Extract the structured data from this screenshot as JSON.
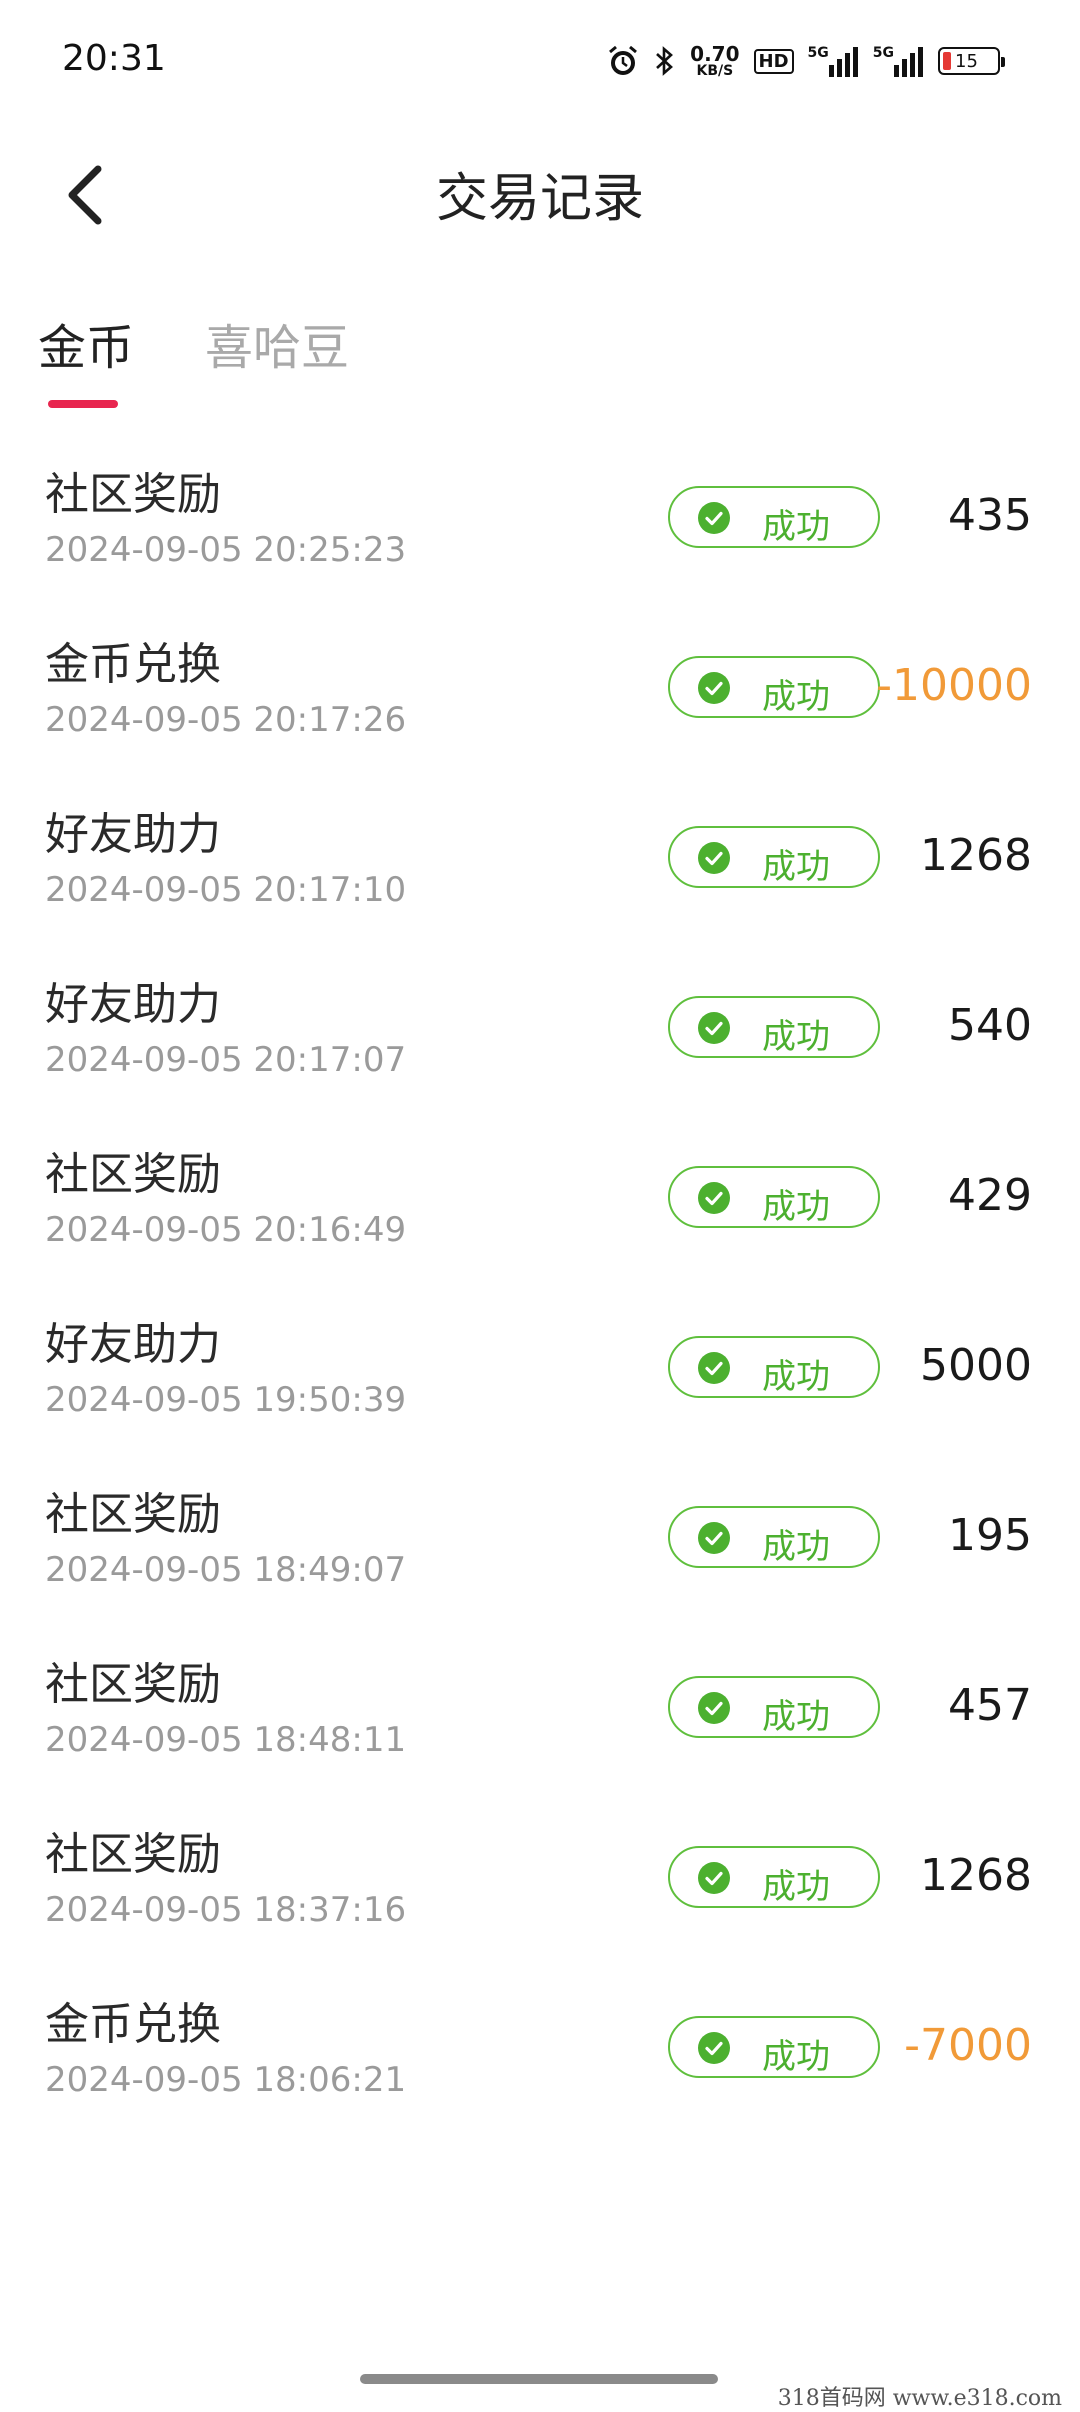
{
  "status_bar": {
    "time": "20:31",
    "net_speed_value": "0.70",
    "net_speed_unit": "KB/S",
    "hd_label": "HD",
    "signal1_label": "5G",
    "signal2_label": "5G",
    "battery_level": "15",
    "battery_color": "#e53935",
    "icons": [
      "alarm-icon",
      "bluetooth-icon",
      "signal-icon",
      "signal-icon",
      "battery-icon"
    ]
  },
  "header": {
    "title": "交易记录",
    "back_icon": "chevron-left-icon"
  },
  "tabs": {
    "items": [
      {
        "label": "金币",
        "active": true
      },
      {
        "label": "喜哈豆",
        "active": false
      }
    ],
    "indicator_color": "#e8264f"
  },
  "records": [
    {
      "title": "社区奖励",
      "time": "2024-09-05 20:25:23",
      "status": "成功",
      "amount": "435"
    },
    {
      "title": "金币兑换",
      "time": "2024-09-05 20:17:26",
      "status": "成功",
      "amount": "-10000"
    },
    {
      "title": "好友助力",
      "time": "2024-09-05 20:17:10",
      "status": "成功",
      "amount": "1268"
    },
    {
      "title": "好友助力",
      "time": "2024-09-05 20:17:07",
      "status": "成功",
      "amount": "540"
    },
    {
      "title": "社区奖励",
      "time": "2024-09-05 20:16:49",
      "status": "成功",
      "amount": "429"
    },
    {
      "title": "好友助力",
      "time": "2024-09-05 19:50:39",
      "status": "成功",
      "amount": "5000"
    },
    {
      "title": "社区奖励",
      "time": "2024-09-05 18:49:07",
      "status": "成功",
      "amount": "195"
    },
    {
      "title": "社区奖励",
      "time": "2024-09-05 18:48:11",
      "status": "成功",
      "amount": "457"
    },
    {
      "title": "社区奖励",
      "time": "2024-09-05 18:37:16",
      "status": "成功",
      "amount": "1268"
    },
    {
      "title": "金币兑换",
      "time": "2024-09-05 18:06:21",
      "status": "成功",
      "amount": "-7000"
    }
  ],
  "colors": {
    "success_green": "#4cb02f",
    "negative_amount": "#f19a38",
    "accent": "#e8264f"
  },
  "watermark": "318首码网 www.e318.com"
}
